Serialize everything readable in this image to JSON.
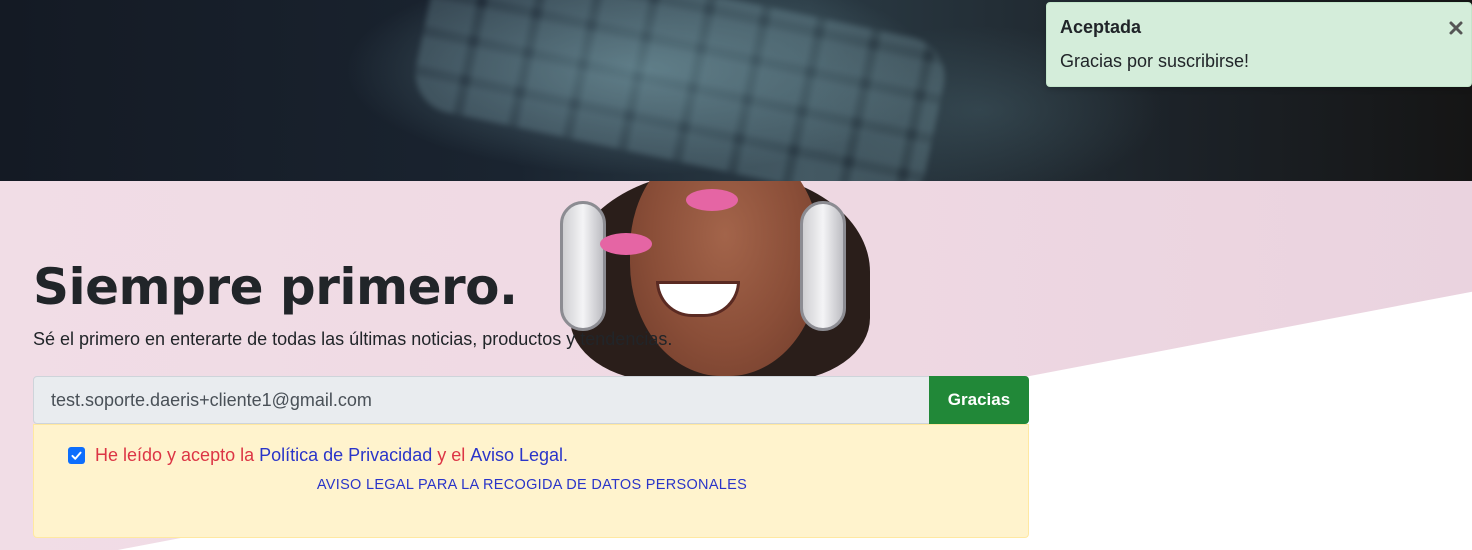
{
  "toast": {
    "title": "Aceptada",
    "message": "Gracias por suscribirse!",
    "close_icon": "close-icon"
  },
  "newsletter": {
    "headline": "Siempre primero.",
    "subtext": "Sé el primero en enterarte de todas las últimas noticias, productos y tendencias.",
    "email_value": "test.soporte.daeris+cliente1@gmail.com",
    "submit_label": "Gracias",
    "consent": {
      "checked": true,
      "prefix": "He leído y acepto la",
      "privacy_link": "Política de Privacidad",
      "joiner": "y el",
      "legal_link": "Aviso Legal",
      "suffix": "."
    },
    "legal_notice_link": "AVISO LEGAL PARA LA RECOGIDA DE DATOS PERSONALES"
  },
  "colors": {
    "submit_bg": "#218838",
    "toast_bg": "#d4edda",
    "consent_bg": "#fff3cd",
    "consent_red": "#dc3545",
    "link_blue": "#2a35c9"
  }
}
